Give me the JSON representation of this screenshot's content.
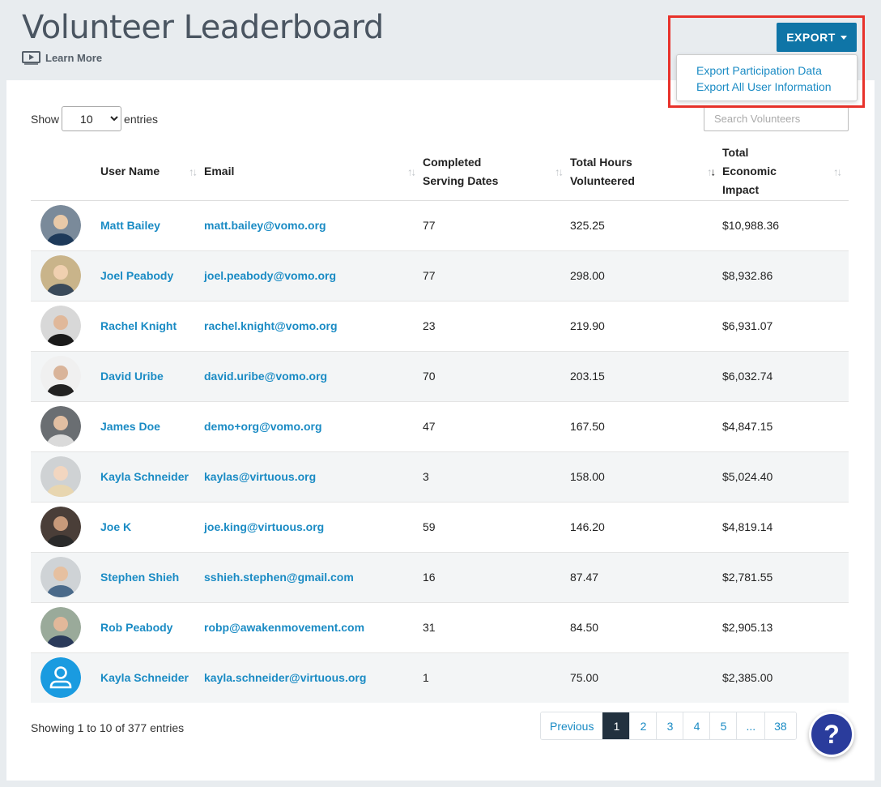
{
  "header": {
    "title": "Volunteer Leaderboard",
    "learn_more": "Learn More"
  },
  "export": {
    "button_label": "EXPORT",
    "menu": [
      "Export Participation Data",
      "Export All User Information"
    ],
    "highlight_color": "#e8322b"
  },
  "controls": {
    "show_label": "Show",
    "entries_label": "entries",
    "page_size": "10",
    "search_placeholder": "Search Volunteers"
  },
  "table": {
    "columns": [
      "User Name",
      "Email",
      "Completed Serving Dates",
      "Total Hours Volunteered",
      "Total Economic Impact"
    ],
    "sort_indicator": "↑↓",
    "sorted_column": "Total Hours Volunteered",
    "rows": [
      {
        "name": "Matt Bailey",
        "email": "matt.bailey@vomo.org",
        "dates": "77",
        "hours": "325.25",
        "impact": "$10,988.36",
        "avatar": "photo"
      },
      {
        "name": "Joel Peabody",
        "email": "joel.peabody@vomo.org",
        "dates": "77",
        "hours": "298.00",
        "impact": "$8,932.86",
        "avatar": "photo"
      },
      {
        "name": "Rachel Knight",
        "email": "rachel.knight@vomo.org",
        "dates": "23",
        "hours": "219.90",
        "impact": "$6,931.07",
        "avatar": "photo"
      },
      {
        "name": "David Uribe",
        "email": "david.uribe@vomo.org",
        "dates": "70",
        "hours": "203.15",
        "impact": "$6,032.74",
        "avatar": "photo"
      },
      {
        "name": "James Doe",
        "email": "demo+org@vomo.org",
        "dates": "47",
        "hours": "167.50",
        "impact": "$4,847.15",
        "avatar": "photo"
      },
      {
        "name": "Kayla Schneider",
        "email": "kaylas@virtuous.org",
        "dates": "3",
        "hours": "158.00",
        "impact": "$5,024.40",
        "avatar": "photo"
      },
      {
        "name": "Joe K",
        "email": "joe.king@virtuous.org",
        "dates": "59",
        "hours": "146.20",
        "impact": "$4,819.14",
        "avatar": "photo"
      },
      {
        "name": "Stephen Shieh",
        "email": "sshieh.stephen@gmail.com",
        "dates": "16",
        "hours": "87.47",
        "impact": "$2,781.55",
        "avatar": "photo"
      },
      {
        "name": "Rob Peabody",
        "email": "robp@awakenmovement.com",
        "dates": "31",
        "hours": "84.50",
        "impact": "$2,905.13",
        "avatar": "photo"
      },
      {
        "name": "Kayla Schneider",
        "email": "kayla.schneider@virtuous.org",
        "dates": "1",
        "hours": "75.00",
        "impact": "$2,385.00",
        "avatar": "default-user-icon"
      }
    ]
  },
  "footer": {
    "info": "Showing 1 to 10 of 377 entries",
    "pages": [
      "Previous",
      "1",
      "2",
      "3",
      "4",
      "5",
      "...",
      "38"
    ],
    "active_page": "1"
  },
  "help_label": "?",
  "colors": {
    "link": "#1a8bc4",
    "export_button": "#0f75a7",
    "active_page": "#22313f",
    "help_button": "#2a3c9c"
  }
}
